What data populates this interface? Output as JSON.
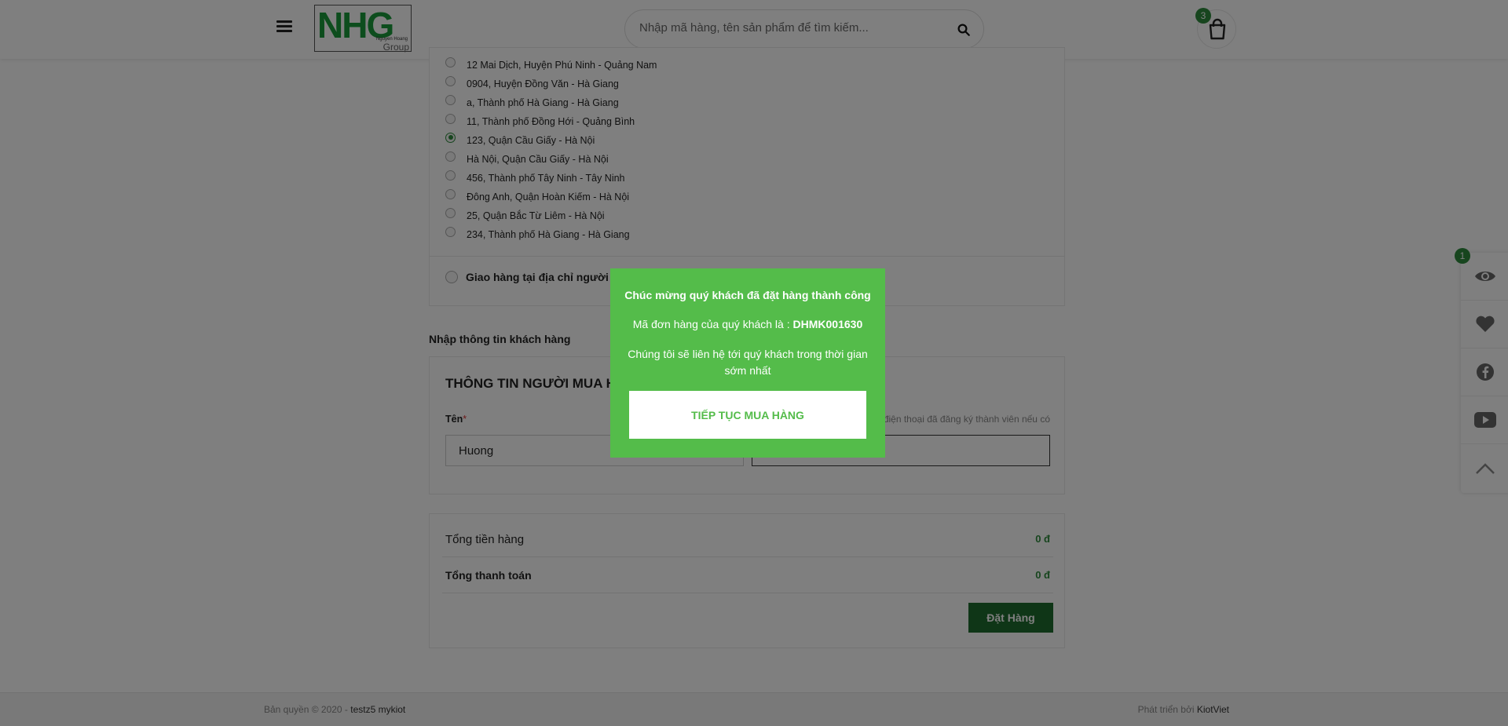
{
  "header": {
    "logo_text": "NHG",
    "logo_subtext": "Nguyen Hoang",
    "logo_group": "Group",
    "search_placeholder": "Nhập mã hàng, tên sản phẩm để tìm kiếm...",
    "cart_count": "3"
  },
  "addresses": {
    "items": [
      "12 Mai Dịch, Huyện Phú Ninh - Quảng Nam",
      "0904, Huyện Đồng Văn - Hà Giang",
      "a, Thành phố Hà Giang - Hà Giang",
      "11, Thành phố Đồng Hới - Quảng Bình",
      "123, Quận Cầu Giấy - Hà Nội",
      "Hà Nội, Quận Cầu Giấy - Hà Nội",
      "456, Thành phố Tây Ninh - Tây Ninh",
      "Đông Anh, Quận Hoàn Kiếm - Hà Nội",
      "25, Quận Bắc Từ Liêm - Hà Nội",
      "234, Thành phố Hà Giang - Hà Giang"
    ],
    "selected_index": 4,
    "alt_option": "Giao hàng tại địa chỉ người nh"
  },
  "buyer": {
    "section_title": "Nhập thông tin khách hàng",
    "heading": "THÔNG TIN NGƯỜI MUA HÀN",
    "name_label": "Tên",
    "required_mark": "*",
    "name_value": "Huong",
    "hint": "điện thoại đã đăng ký thành viên nếu có"
  },
  "summary": {
    "subtotal_label": "Tổng tiền hàng",
    "subtotal_value": "0 đ",
    "total_label": "Tổng thanh toán",
    "total_value": "0 đ",
    "order_button": "Đặt Hàng"
  },
  "footer": {
    "copyright_prefix": "Bản quyền © 2020 - ",
    "shop_name": "testz5 mykiot",
    "developed_prefix": "Phát triển bởi ",
    "developer": "KiotViet"
  },
  "sidebar": {
    "viewed_count": "1",
    "icons": [
      "eye-icon",
      "heart-icon",
      "facebook-icon",
      "youtube-icon",
      "chevron-up-icon"
    ]
  },
  "modal": {
    "title": "Chúc mừng quý khách đã đặt hàng thành công",
    "order_prefix": "Mã đơn hàng của quý khách là : ",
    "order_code": "DHMK001630",
    "message": "Chúng tôi sẽ liên hệ tới quý khách trong thời gian sớm nhất",
    "continue_button": "TIẾP TỤC MUA HÀNG"
  },
  "colors": {
    "brand_green": "#2e8b3d",
    "modal_green": "#54bc4a",
    "button_dark_green": "#1f6d2e"
  }
}
